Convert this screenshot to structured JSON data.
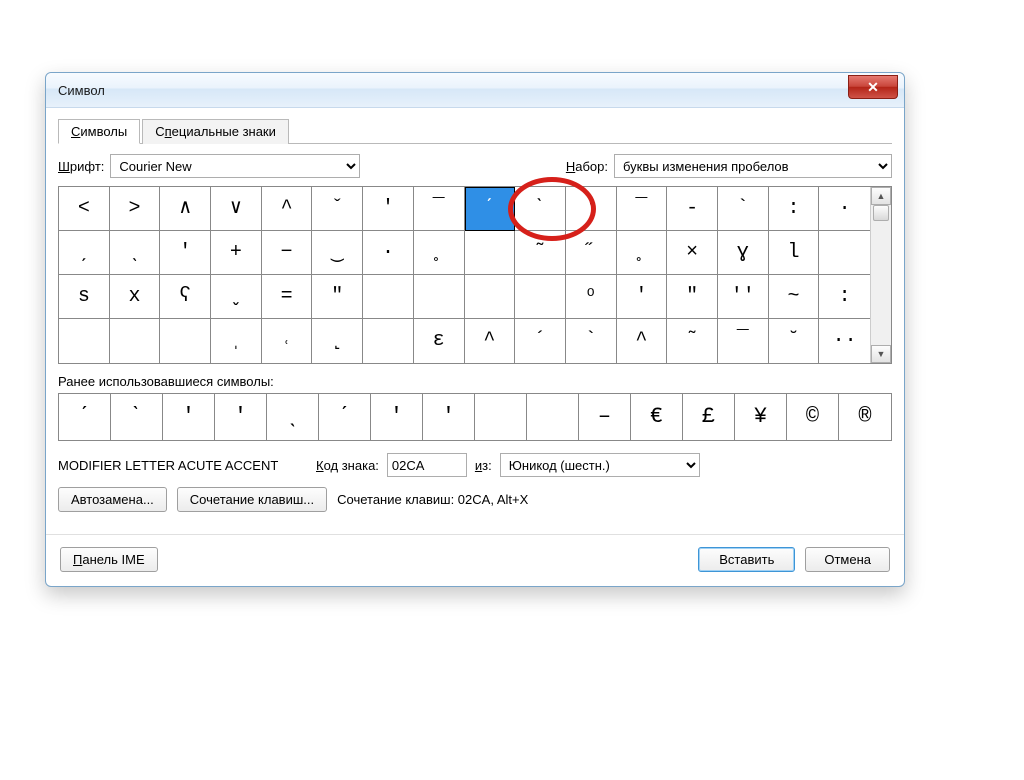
{
  "title": "Символ",
  "close_glyph": "✕",
  "tabs": {
    "symbols": "Символы",
    "special": "Специальные знаки"
  },
  "font_label": "Шрифт:",
  "font_value": "Courier New",
  "set_label": "Набор:",
  "set_value": "буквы изменения пробелов",
  "grid_rows": [
    [
      "<",
      ">",
      "∧",
      "∨",
      "^",
      "ˇ",
      "'",
      "¯",
      "ˊ",
      "ˋ",
      "'",
      "¯",
      "-",
      "`",
      ":",
      "·"
    ],
    [
      "ˏ",
      "ˎ",
      "'",
      "+",
      "−",
      "‿",
      "·",
      "˳",
      "",
      "˜",
      "˝",
      "˳",
      "×",
      "ɣ",
      "l",
      ""
    ],
    [
      "ѕ",
      "x",
      "ʕ",
      "ˬ",
      "=",
      "ʺ",
      "",
      "",
      "",
      "",
      "ͦ",
      "'",
      "ʺ",
      "ʹʹ",
      "~",
      ":"
    ],
    [
      "",
      "",
      "",
      "ˌ",
      "˓",
      "˻",
      "",
      "ɛ",
      "^",
      "´",
      "`",
      "^",
      "˜",
      "¯",
      "˘",
      "··"
    ]
  ],
  "selected_index": 8,
  "recent_label": "Ранее использовавшиеся символы:",
  "recent": [
    "ˊ",
    "ˋ",
    "'",
    "'",
    "ˎ",
    "ˊ",
    "'",
    "'",
    "",
    "",
    "–",
    "€",
    "£",
    "¥",
    "©",
    "®"
  ],
  "char_name": "MODIFIER LETTER ACUTE ACCENT",
  "code_label": "Код знака:",
  "code_value": "02CA",
  "from_label": "из:",
  "from_value": "Юникод (шестн.)",
  "btn_autocorrect": "Автозамена...",
  "btn_shortcut": "Сочетание клавиш...",
  "shortcut_text": "Сочетание клавиш: 02CA, Alt+X",
  "btn_ime": "Панель IME",
  "btn_insert": "Вставить",
  "btn_cancel": "Отмена"
}
